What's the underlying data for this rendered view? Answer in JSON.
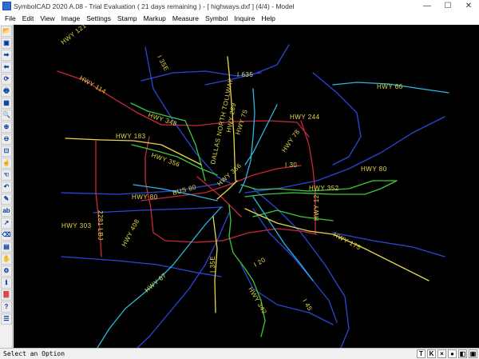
{
  "window": {
    "title": "SymbolCAD 2020 A.08 - Trial Evaluation ( 21 days remaining ) - [ highways.dxf ] (4/4) - Model",
    "minimize": "—",
    "maximize": "☐",
    "close": "✕"
  },
  "menu": [
    "File",
    "Edit",
    "View",
    "Image",
    "Settings",
    "Stamp",
    "Markup",
    "Measure",
    "Symbol",
    "Inquire",
    "Help"
  ],
  "toolbar": {
    "tools": [
      {
        "name": "open-icon",
        "glyph": "📂"
      },
      {
        "name": "save-icon",
        "glyph": "▣"
      },
      {
        "name": "forward-icon",
        "glyph": "➡"
      },
      {
        "name": "back-icon",
        "glyph": "⬅"
      },
      {
        "name": "refresh-icon",
        "glyph": "⟳"
      },
      {
        "name": "print-icon",
        "glyph": "🖶"
      },
      {
        "name": "toolbar-icon",
        "glyph": "▦"
      },
      {
        "name": "zoom-icon",
        "glyph": "🔍"
      },
      {
        "name": "zoom-in-icon",
        "glyph": "⊕"
      },
      {
        "name": "zoom-out-icon",
        "glyph": "⊖"
      },
      {
        "name": "zoom-window-icon",
        "glyph": "⊡"
      },
      {
        "name": "pan-icon",
        "glyph": "☝"
      },
      {
        "name": "select-icon",
        "glyph": "☜"
      },
      {
        "name": "undo-icon",
        "glyph": "↶"
      },
      {
        "name": "pencil-icon",
        "glyph": "✎"
      },
      {
        "name": "text-icon",
        "glyph": "ab"
      },
      {
        "name": "dimension-icon",
        "glyph": "↗"
      },
      {
        "name": "eraser-icon",
        "glyph": "⌫"
      },
      {
        "name": "layer-icon",
        "glyph": "▤"
      },
      {
        "name": "hand-icon",
        "glyph": "✋"
      },
      {
        "name": "settings-icon",
        "glyph": "⚙"
      },
      {
        "name": "info-icon",
        "glyph": "ℹ"
      },
      {
        "name": "book-icon",
        "glyph": "📕"
      },
      {
        "name": "help-icon",
        "glyph": "?"
      },
      {
        "name": "properties-icon",
        "glyph": "☰"
      }
    ]
  },
  "drawing": {
    "background": "#000000",
    "colors": {
      "yellow": "#e6d84a",
      "red": "#c8283c",
      "blue": "#2a46d8",
      "cyan": "#2ab8e0",
      "green": "#3ec83e",
      "label": "#e6d84a"
    },
    "labels": [
      {
        "name": "hwy-121",
        "text": "HWY 121"
      },
      {
        "name": "i-35e-north",
        "text": "I 35E"
      },
      {
        "name": "i-635",
        "text": "I 635"
      },
      {
        "name": "hwy-66",
        "text": "HWY 66"
      },
      {
        "name": "hwy-114",
        "text": "HWY 114"
      },
      {
        "name": "dallas-north-tollway",
        "text": "DALLAS NORTH TOLLWAY"
      },
      {
        "name": "hwy-289",
        "text": "HWY 289"
      },
      {
        "name": "hwy-348",
        "text": "HWY 348"
      },
      {
        "name": "hwy-244",
        "text": "HWY 244"
      },
      {
        "name": "hwy-75",
        "text": "HWY 75"
      },
      {
        "name": "hwy-183",
        "text": "HWY 183"
      },
      {
        "name": "hwy-78",
        "text": "HWY 78"
      },
      {
        "name": "hwy-356",
        "text": "HWY 356"
      },
      {
        "name": "hwy-366",
        "text": "HWY 366"
      },
      {
        "name": "i-30",
        "text": "I 30"
      },
      {
        "name": "hwy-80-east",
        "text": "HWY 80"
      },
      {
        "name": "bus-80",
        "text": "BUS 80"
      },
      {
        "name": "hwy-352",
        "text": "HWY 352"
      },
      {
        "name": "hwy-80-west",
        "text": "HWY 80"
      },
      {
        "name": "hwy-12",
        "text": "HWY 12"
      },
      {
        "name": "lbj-2281",
        "text": "2281 LBJ"
      },
      {
        "name": "hwy-303",
        "text": "HWY 303"
      },
      {
        "name": "hwy-175",
        "text": "HWY 175"
      },
      {
        "name": "hwy-408",
        "text": "HWY 408"
      },
      {
        "name": "i-35e-south",
        "text": "I 35E"
      },
      {
        "name": "i-20",
        "text": "I 20"
      },
      {
        "name": "hwy-67",
        "text": "HWY 67"
      },
      {
        "name": "hwy-342",
        "text": "HWY 342"
      },
      {
        "name": "i-45",
        "text": "I 45"
      }
    ]
  },
  "status": {
    "text": "Select an Option",
    "icons": [
      "T",
      "K",
      "×",
      "●",
      "◧",
      "▣"
    ]
  }
}
